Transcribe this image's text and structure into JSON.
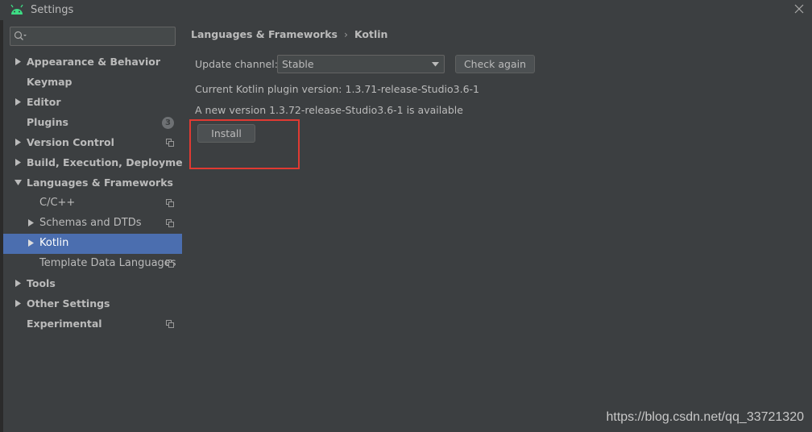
{
  "window": {
    "title": "Settings",
    "icons": {
      "app": "android-icon",
      "close": "close-icon"
    }
  },
  "sidebar": {
    "search": {
      "placeholder": "",
      "value": "",
      "icon": "search-icon"
    },
    "items": [
      {
        "label": "Appearance & Behavior",
        "bold": true,
        "arrow": "right",
        "indent": 0
      },
      {
        "label": "Keymap",
        "bold": true,
        "arrow": "",
        "indent": 0
      },
      {
        "label": "Editor",
        "bold": true,
        "arrow": "right",
        "indent": 0
      },
      {
        "label": "Plugins",
        "bold": true,
        "arrow": "",
        "indent": 0,
        "badge": "3"
      },
      {
        "label": "Version Control",
        "bold": true,
        "arrow": "right",
        "indent": 0,
        "copy": true
      },
      {
        "label": "Build, Execution, Deployment",
        "bold": true,
        "arrow": "right",
        "indent": 0
      },
      {
        "label": "Languages & Frameworks",
        "bold": true,
        "arrow": "down",
        "indent": 0
      },
      {
        "label": "C/C++",
        "bold": false,
        "arrow": "",
        "indent": 1,
        "copy": true
      },
      {
        "label": "Schemas and DTDs",
        "bold": false,
        "arrow": "right",
        "indent": 1,
        "copy": true
      },
      {
        "label": "Kotlin",
        "bold": false,
        "arrow": "right",
        "indent": 1,
        "selected": true
      },
      {
        "label": "Template Data Languages",
        "bold": false,
        "arrow": "",
        "indent": 1,
        "copy": true
      },
      {
        "label": "Tools",
        "bold": true,
        "arrow": "right",
        "indent": 0
      },
      {
        "label": "Other Settings",
        "bold": true,
        "arrow": "right",
        "indent": 0
      },
      {
        "label": "Experimental",
        "bold": true,
        "arrow": "",
        "indent": 0,
        "copy": true
      }
    ]
  },
  "main": {
    "breadcrumb": {
      "parent": "Languages & Frameworks",
      "separator": "›",
      "current": "Kotlin"
    },
    "update_channel_label": "Update channel:",
    "update_channel_value": "Stable",
    "check_again_label": "Check again",
    "current_version_text": "Current Kotlin plugin version:  1.3.71-release-Studio3.6-1",
    "new_version_text": "A new version 1.3.72-release-Studio3.6-1 is available",
    "install_label": "Install"
  },
  "watermark": "https://blog.csdn.net/qq_33721320",
  "colors": {
    "background": "#3c3f41",
    "selection": "#4b6eaf",
    "highlight": "#e03a32",
    "text": "#bbbbbb"
  }
}
